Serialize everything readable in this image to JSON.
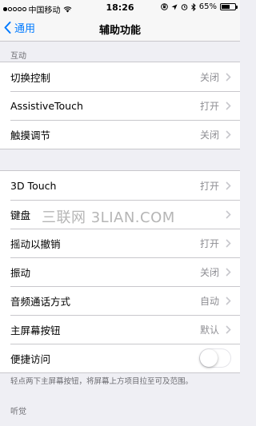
{
  "status_bar": {
    "carrier": "中国移动",
    "time": "18:26",
    "battery_percent": "65%",
    "battery_level": 0.65,
    "signal_bars_filled": 1,
    "icons": [
      "signal-dots-icon",
      "wifi-icon",
      "lock-rotation-icon",
      "location-icon",
      "alarm-icon",
      "bluetooth-icon",
      "battery-icon"
    ]
  },
  "nav": {
    "back_label": "通用",
    "title": "辅助功能"
  },
  "section_interaction": {
    "header": "互动",
    "rows": [
      {
        "label": "切换控制",
        "value": "关闭"
      },
      {
        "label": "AssistiveTouch",
        "value": "打开"
      },
      {
        "label": "触摸调节",
        "value": "关闭"
      }
    ]
  },
  "section_touch": {
    "rows": [
      {
        "label": "3D Touch",
        "value": "打开"
      },
      {
        "label": "键盘",
        "value": ""
      },
      {
        "label": "摇动以撤销",
        "value": "打开"
      },
      {
        "label": "振动",
        "value": "关闭"
      },
      {
        "label": "音频通话方式",
        "value": "自动"
      },
      {
        "label": "主屏幕按钮",
        "value": "默认"
      }
    ],
    "reachability": {
      "label": "便捷访问",
      "enabled": false
    },
    "footer": "轻点两下主屏幕按钮，将屏幕上方项目拉至可及范围。"
  },
  "section_hearing": {
    "header": "听觉"
  },
  "watermark": "三联网 3LIAN.COM"
}
